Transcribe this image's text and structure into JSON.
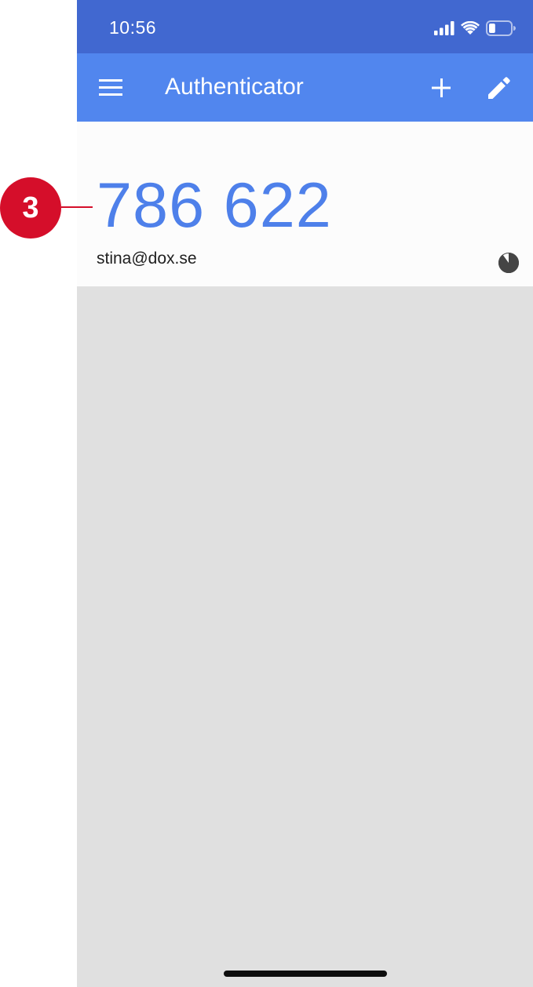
{
  "status_bar": {
    "time": "10:56",
    "icons": [
      "cellular-signal-icon",
      "wifi-icon",
      "battery-icon"
    ],
    "battery_level": 0.3
  },
  "app_bar": {
    "title": "Authenticator",
    "icons": [
      "menu-icon",
      "plus-icon",
      "pencil-icon"
    ]
  },
  "account": {
    "code": "786 622",
    "name": "stina@dox.se",
    "timer_remaining_fraction": 0.9
  },
  "callout": {
    "number": "3"
  },
  "colors": {
    "status_bar_bg": "#4168d0",
    "app_bar_bg": "#5186ee",
    "code_color": "#4e80ea",
    "list_bg": "#e0e0e0",
    "callout_red": "#d50e2a"
  }
}
